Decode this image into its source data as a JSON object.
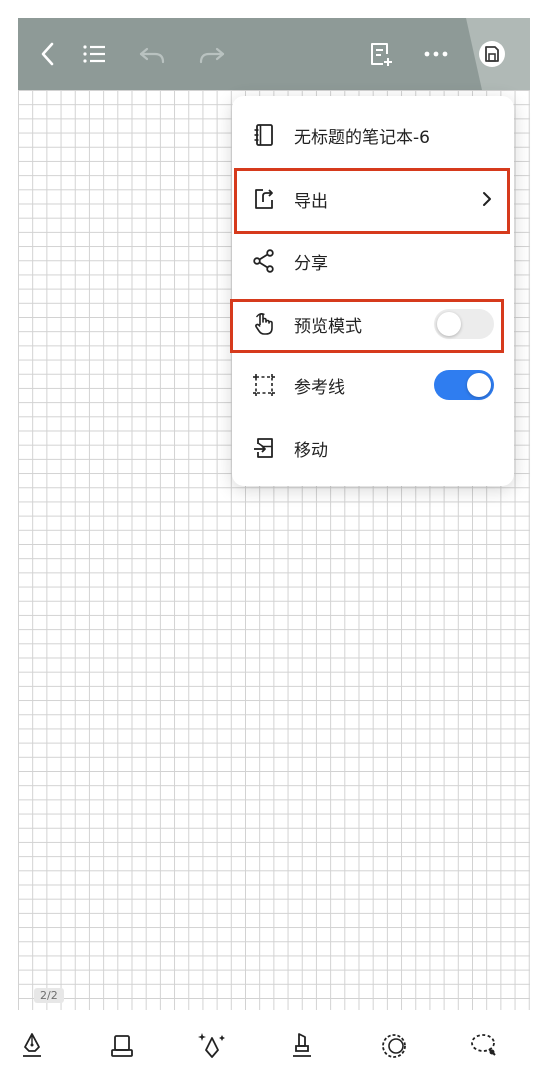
{
  "toolbar": {
    "icons": [
      "back-icon",
      "list-icon",
      "undo-icon",
      "redo-icon",
      "add-page-icon",
      "more-icon",
      "save-icon"
    ]
  },
  "menu": {
    "items": [
      {
        "label": "无标题的笔记本-6",
        "icon": "notebook-icon"
      },
      {
        "label": "导出",
        "icon": "export-icon",
        "has_submenu": true
      },
      {
        "label": "分享",
        "icon": "share-icon"
      },
      {
        "label": "预览模式",
        "icon": "hand-icon",
        "toggle": false
      },
      {
        "label": "参考线",
        "icon": "guideline-icon",
        "toggle": true
      },
      {
        "label": "移动",
        "icon": "move-icon"
      }
    ]
  },
  "canvas": {
    "page_indicator": "2/2"
  },
  "bottom_tools": [
    "pen-icon",
    "eraser-icon",
    "magic-pen-icon",
    "highlighter-icon",
    "shape-icon",
    "lasso-icon"
  ],
  "colors": {
    "toolbar_bg": "#8e9a97",
    "toggle_on": "#2f7df0",
    "highlight_red": "#d63a1c",
    "grid_line": "#d2d2d2"
  }
}
